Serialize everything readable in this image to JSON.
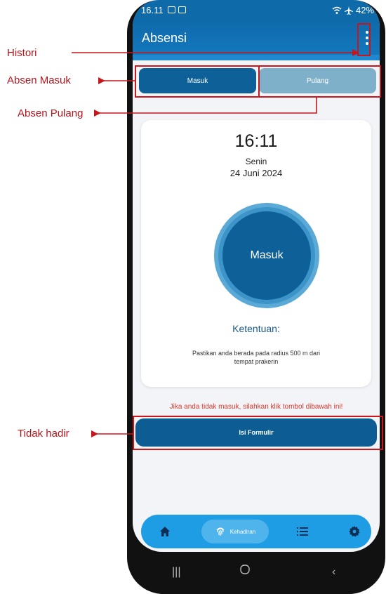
{
  "annotations": {
    "histori": "Histori",
    "absen_masuk": "Absen Masuk",
    "absen_pulang": "Absen Pulang",
    "tidak_hadir": "Tidak hadir"
  },
  "status_bar": {
    "time": "16.11",
    "battery": "42%"
  },
  "appbar": {
    "title": "Absensi",
    "menu_icon": "more-vertical-icon"
  },
  "tabs": {
    "masuk": "Masuk",
    "pulang": "Pulang"
  },
  "card": {
    "clock": "16:11",
    "day": "Senin",
    "date": "24 Juni 2024",
    "button_label": "Masuk",
    "rules_title": "Ketentuan:",
    "rules_text": "Pastikan anda berada pada radius 500 m dari tempat prakerin"
  },
  "warning_text": "Jika anda tidak masuk, silahkan klik tombol dibawah ini!",
  "form_button": "Isi Formulir",
  "bottom_nav": {
    "active_label": "Kehadiran",
    "icons": [
      "home-icon",
      "fingerprint-icon",
      "list-icon",
      "gear-icon"
    ]
  },
  "colors": {
    "primary": "#0d6198",
    "accent": "#1e9de4",
    "annotation": "#b5161c",
    "warning": "#d93a2e"
  }
}
